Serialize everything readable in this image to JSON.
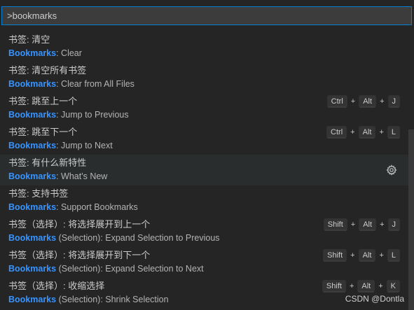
{
  "command_input": {
    "value": ">bookmarks"
  },
  "items": [
    {
      "label": "书签: 清空",
      "detail_prefix": "Bookmarks",
      "detail_suffix": ": Clear",
      "keys": []
    },
    {
      "label": "书签: 清空所有书签",
      "detail_prefix": "Bookmarks",
      "detail_suffix": ": Clear from All Files",
      "keys": []
    },
    {
      "label": "书签: 跳至上一个",
      "detail_prefix": "Bookmarks",
      "detail_suffix": ": Jump to Previous",
      "keys": [
        "Ctrl",
        "Alt",
        "J"
      ]
    },
    {
      "label": "书签: 跳至下一个",
      "detail_prefix": "Bookmarks",
      "detail_suffix": ": Jump to Next",
      "keys": [
        "Ctrl",
        "Alt",
        "L"
      ]
    },
    {
      "label": "书签: 有什么新特性",
      "detail_prefix": "Bookmarks",
      "detail_suffix": ": What's New",
      "keys": [],
      "gear": true,
      "highlight": true
    },
    {
      "label": "书签: 支持书签",
      "detail_prefix": "Bookmarks",
      "detail_suffix": ": Support Bookmarks",
      "keys": []
    },
    {
      "label": "书签（选择）: 将选择展开到上一个",
      "detail_prefix": "Bookmarks",
      "detail_suffix": " (Selection): Expand Selection to Previous",
      "keys": [
        "Shift",
        "Alt",
        "J"
      ]
    },
    {
      "label": "书签（选择）: 将选择展开到下一个",
      "detail_prefix": "Bookmarks",
      "detail_suffix": " (Selection): Expand Selection to Next",
      "keys": [
        "Shift",
        "Alt",
        "L"
      ]
    },
    {
      "label": "书签（选择）: 收缩选择",
      "detail_prefix": "Bookmarks",
      "detail_suffix": " (Selection): Shrink Selection",
      "keys": [
        "Shift",
        "Alt",
        "K"
      ]
    }
  ],
  "keys_separator": "+",
  "watermark": "CSDN @Dontla",
  "colors": {
    "background": "#252526",
    "input_background": "#3c3c3c",
    "input_border": "#007fd4",
    "highlight_text": "#3794ff",
    "hover_row": "#2a2d2e"
  },
  "icons": {
    "settings": "gear-icon"
  }
}
